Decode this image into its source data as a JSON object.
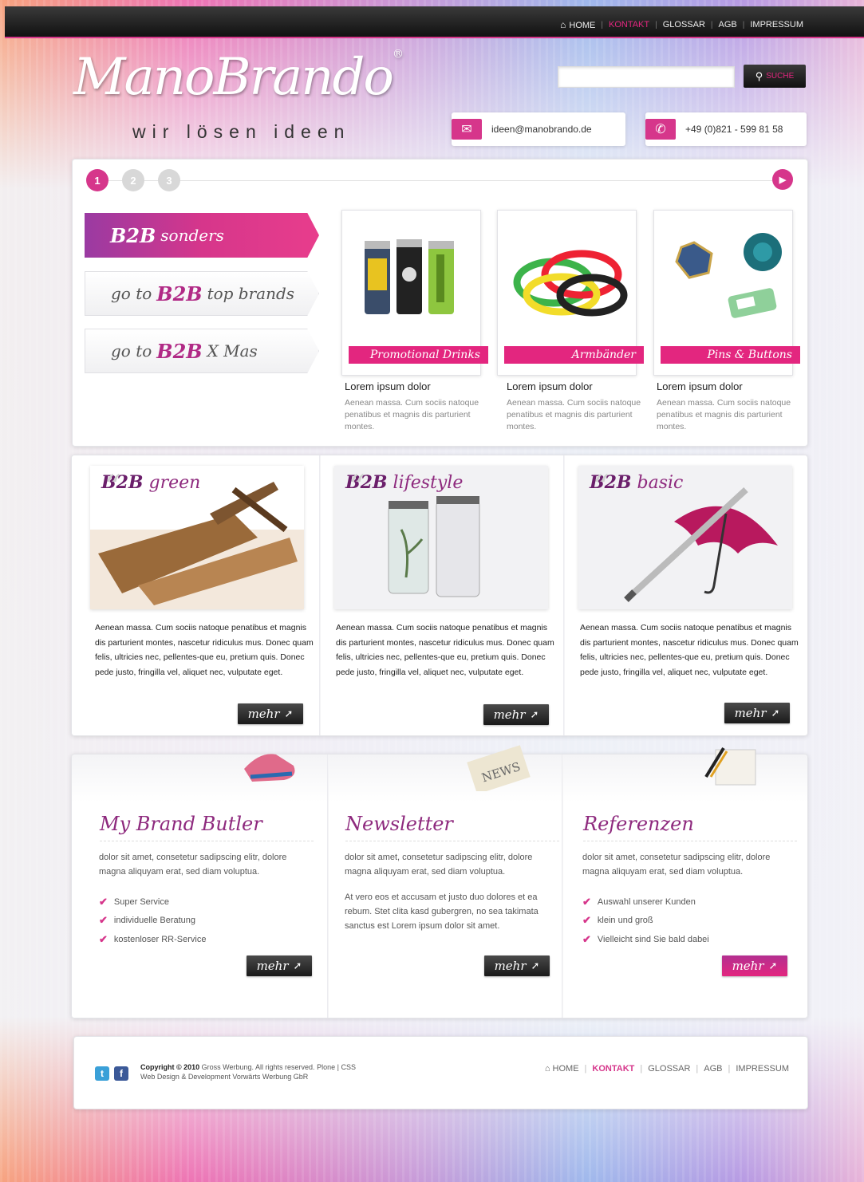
{
  "nav": {
    "home": "HOME",
    "items": [
      "KONTAKT",
      "GLOSSAR",
      "AGB",
      "IMPRESSUM"
    ],
    "active": "KONTAKT"
  },
  "brand": {
    "logo": "ManoBrando",
    "registered": "®",
    "tagline": "wir lösen ideen"
  },
  "search": {
    "value": "",
    "button_label": "SUCHE"
  },
  "contact": {
    "email": "ideen@manobrando.de",
    "phone": "+49 (0)821 - 599 81 58"
  },
  "slider": {
    "steps": [
      "1",
      "2",
      "3"
    ],
    "active_step": "1",
    "next_icon": "play-arrow-icon"
  },
  "tabs": [
    {
      "prefix": "",
      "bold": "B2B",
      "suffix": "sonders",
      "active": true
    },
    {
      "prefix": "go to",
      "bold": "B2B",
      "suffix": "top brands",
      "active": false
    },
    {
      "prefix": "go to",
      "bold": "B2B",
      "suffix": "X Mas",
      "active": false
    }
  ],
  "products": [
    {
      "label": "Promotional Drinks",
      "title": "Lorem ipsum dolor",
      "desc": "Aenean massa. Cum sociis natoque penatibus et magnis dis parturient montes."
    },
    {
      "label": "Armbänder",
      "title": "Lorem ipsum dolor",
      "desc": "Aenean massa. Cum sociis natoque penatibus et magnis dis parturient montes."
    },
    {
      "label": "Pins & Buttons",
      "title": "Lorem ipsum dolor",
      "desc": "Aenean massa. Cum sociis natoque penatibus et magnis dis parturient montes."
    }
  ],
  "features": [
    {
      "bold": "B2B",
      "title": "green",
      "text": "Aenean massa. Cum sociis natoque penatibus et magnis dis parturient montes, nascetur ridiculus mus. Donec quam felis, ultricies nec, pellentes-que eu, pretium quis. Donec pede justo, fringilla vel, aliquet nec, vulputate eget.",
      "button": "mehr"
    },
    {
      "bold": "B2B",
      "title": "lifestyle",
      "text": "Aenean massa. Cum sociis natoque penatibus et magnis dis parturient montes, nascetur ridiculus mus. Donec quam felis, ultricies nec, pellentes-que eu, pretium quis. Donec pede justo, fringilla vel, aliquet nec, vulputate eget.",
      "button": "mehr"
    },
    {
      "bold": "B2B",
      "title": "basic",
      "text": "Aenean massa. Cum sociis natoque penatibus et magnis dis parturient montes, nascetur ridiculus mus. Donec quam felis, ultricies nec, pellentes-que eu, pretium quis. Donec pede justo, fringilla vel, aliquet nec, vulputate eget.",
      "button": "mehr"
    }
  ],
  "boxes": [
    {
      "title": "My Brand Butler",
      "text": "dolor sit amet, consetetur sadipscing elitr, dolore magna aliquyam erat, sed diam voluptua.",
      "list": [
        "Super Service",
        "individuelle Beratung",
        "kostenloser RR-Service"
      ],
      "button": "mehr"
    },
    {
      "title": "Newsletter",
      "text": "dolor sit amet, consetetur sadipscing elitr, dolore magna aliquyam erat, sed diam voluptua.",
      "text2": "At vero eos et accusam et justo duo dolores et ea rebum. Stet clita kasd gubergren, no sea takimata sanctus est Lorem ipsum dolor sit amet.",
      "button": "mehr"
    },
    {
      "title": "Referenzen",
      "text": "dolor sit amet, consetetur sadipscing elitr, dolore magna aliquyam erat, sed diam voluptua.",
      "list": [
        "Auswahl unserer Kunden",
        "klein und groß",
        "Vielleicht sind Sie bald dabei"
      ],
      "button": "mehr"
    }
  ],
  "footer": {
    "copyright_bold": "Copyright © 2010",
    "copyright_rest": "Gross Werbung. All rights reserved.",
    "plone": "Plone",
    "css": "CSS",
    "credit": "Web Design & Development Vorwärts Werbung GbR",
    "nav": [
      "HOME",
      "KONTAKT",
      "GLOSSAR",
      "AGB",
      "IMPRESSUM"
    ],
    "active": "KONTAKT"
  },
  "colors": {
    "accent": "#d6368b",
    "accent_dark": "#8e2a7e",
    "topbar": "#1a1a1a"
  }
}
